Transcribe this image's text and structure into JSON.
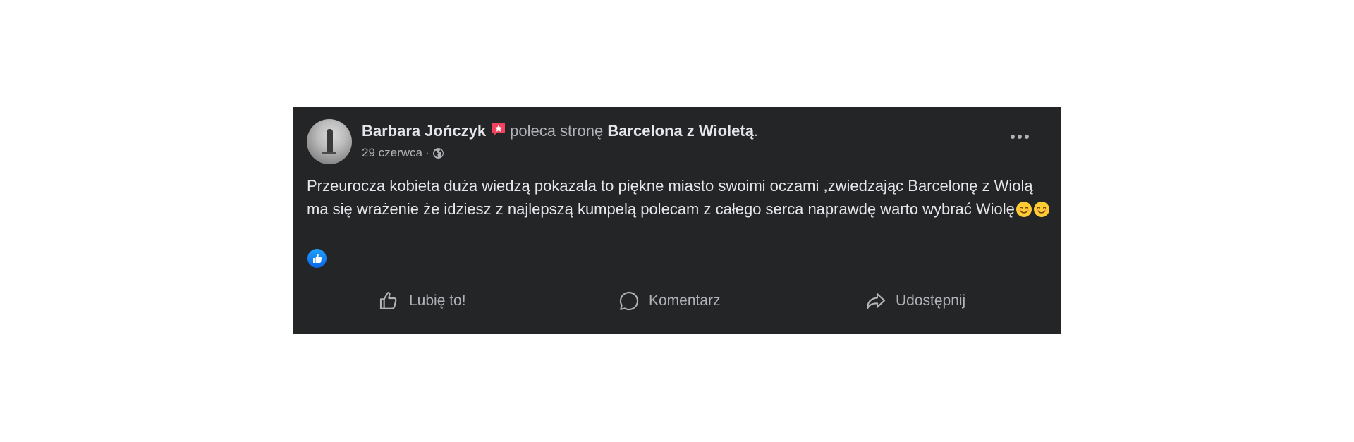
{
  "post": {
    "author": "Barbara Jończyk",
    "verb": "poleca stronę",
    "page_name": "Barcelona z Wioletą",
    "page_suffix": ".",
    "date": "29 czerwca",
    "meta_separator": "·",
    "audience_icon": "globe-icon",
    "recommend_icon": "recommendation-star-icon",
    "avatar": "avatar",
    "body_text": "Przeurocza kobieta duża wiedzą pokazała to piękne miasto swoimi oczami ,zwiedzając Barcelonę z Wiolą ma się wrażenie że idziesz z najlepszą kumpelą polecam z całego serca naprawdę warto wybrać Wiolę",
    "body_emojis": [
      "smiling-face-emoji",
      "smiling-face-emoji"
    ],
    "reactions": [
      "like-reaction-icon"
    ],
    "more_icon": "more-options-icon"
  },
  "actions": {
    "like_label": "Lubię to!",
    "comment_label": "Komentarz",
    "share_label": "Udostępnij"
  },
  "colors": {
    "card_background": "#242526",
    "primary_text": "#e4e6eb",
    "secondary_text": "#b0b3b8",
    "divider": "#3e4042",
    "like_blue": "#1877f2",
    "recommend_red": "#f3425f"
  }
}
